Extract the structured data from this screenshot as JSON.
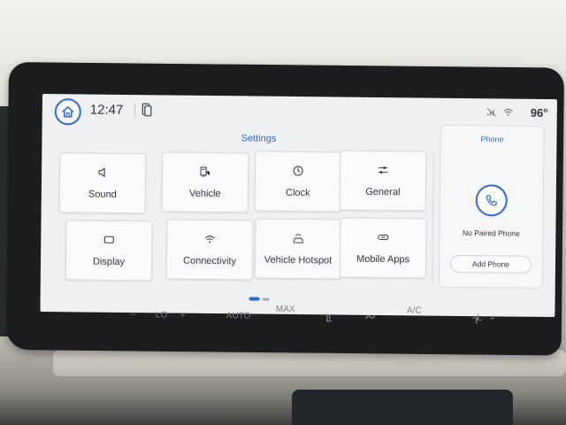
{
  "status_bar": {
    "time": "12:47",
    "outside_temp": "96°"
  },
  "settings": {
    "title": "Settings",
    "tiles": [
      {
        "label": "Sound",
        "icon": "speaker-icon"
      },
      {
        "label": "Vehicle",
        "icon": "vehicle-icon"
      },
      {
        "label": "Clock",
        "icon": "clock-icon"
      },
      {
        "label": "General",
        "icon": "sliders-icon"
      },
      {
        "label": "Display",
        "icon": "display-icon"
      },
      {
        "label": "Connectivity",
        "icon": "wifi-icon"
      },
      {
        "label": "Vehicle Hotspot",
        "icon": "hotspot-icon"
      },
      {
        "label": "Mobile Apps",
        "icon": "link-icon"
      }
    ],
    "page_indicator": {
      "current": 1,
      "total": 2
    }
  },
  "phone": {
    "title": "Phone",
    "status": "No Paired Phone",
    "add_label": "Add Phone"
  },
  "climate": {
    "fan_label": "LO",
    "auto_label": "AUTO",
    "max_label": "MAX",
    "ac_label": "A/C"
  },
  "colors": {
    "accent": "#2c6bd6",
    "screen_bg": "#eef0f2",
    "tile_bg": "#f9fafb"
  }
}
